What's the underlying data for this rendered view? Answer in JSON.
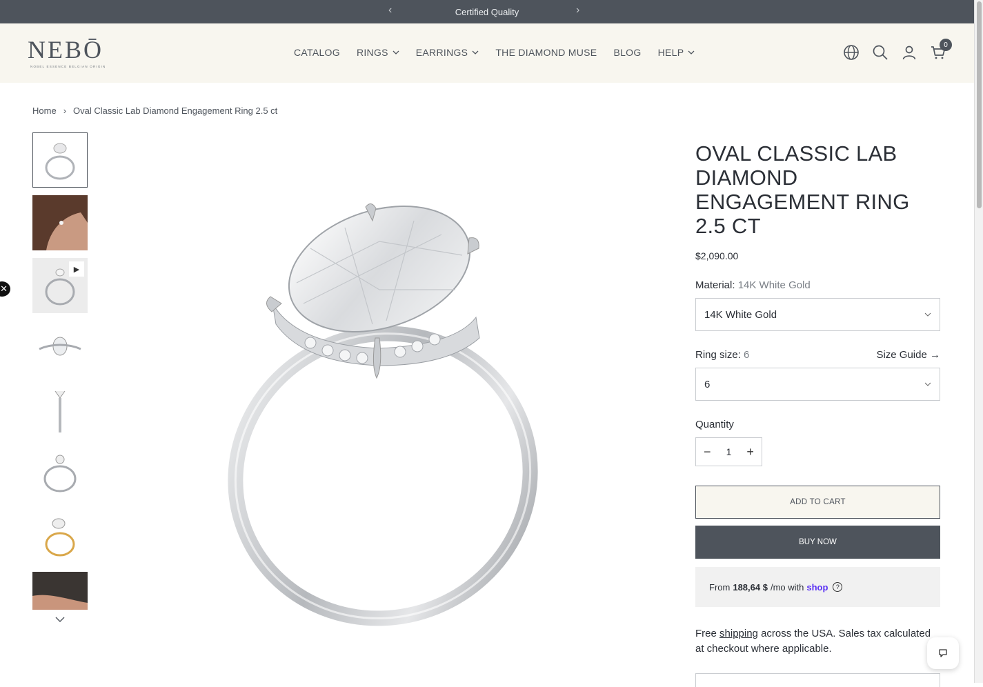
{
  "announcement": {
    "text": "Certified Quality"
  },
  "header": {
    "logo": {
      "word": "NEBŌ",
      "tagline": "NOBEL ESSENCE BELGIAN ORIGIN"
    },
    "nav": [
      {
        "label": "CATALOG",
        "dropdown": false
      },
      {
        "label": "RINGS",
        "dropdown": true
      },
      {
        "label": "EARRINGS",
        "dropdown": true
      },
      {
        "label": "THE DIAMOND MUSE",
        "dropdown": false
      },
      {
        "label": "BLOG",
        "dropdown": false
      },
      {
        "label": "HELP",
        "dropdown": true
      }
    ],
    "cart_count": "0"
  },
  "breadcrumb": {
    "home": "Home",
    "current": "Oval Classic Lab Diamond Engagement Ring 2.5 ct"
  },
  "product": {
    "title": "OVAL CLASSIC LAB DIAMOND ENGAGEMENT RING 2.5 CT",
    "price": "$2,090.00",
    "material": {
      "label": "Material:",
      "value": "14K White Gold",
      "selected": "14K White Gold"
    },
    "ring_size": {
      "label": "Ring size:",
      "value": "6",
      "selected": "6",
      "guide": "Size Guide →"
    },
    "quantity": {
      "label": "Quantity",
      "value": "1"
    },
    "add_to_cart": "ADD TO CART",
    "buy_now": "BUY NOW",
    "shoppay": {
      "prefix": "From",
      "amount": "188,64 $",
      "suffix": "/mo with",
      "brand": "shop"
    },
    "shipping": {
      "pre": "Free",
      "link": "shipping",
      "post": "across the USA. Sales tax calculated at checkout where applicable."
    }
  }
}
